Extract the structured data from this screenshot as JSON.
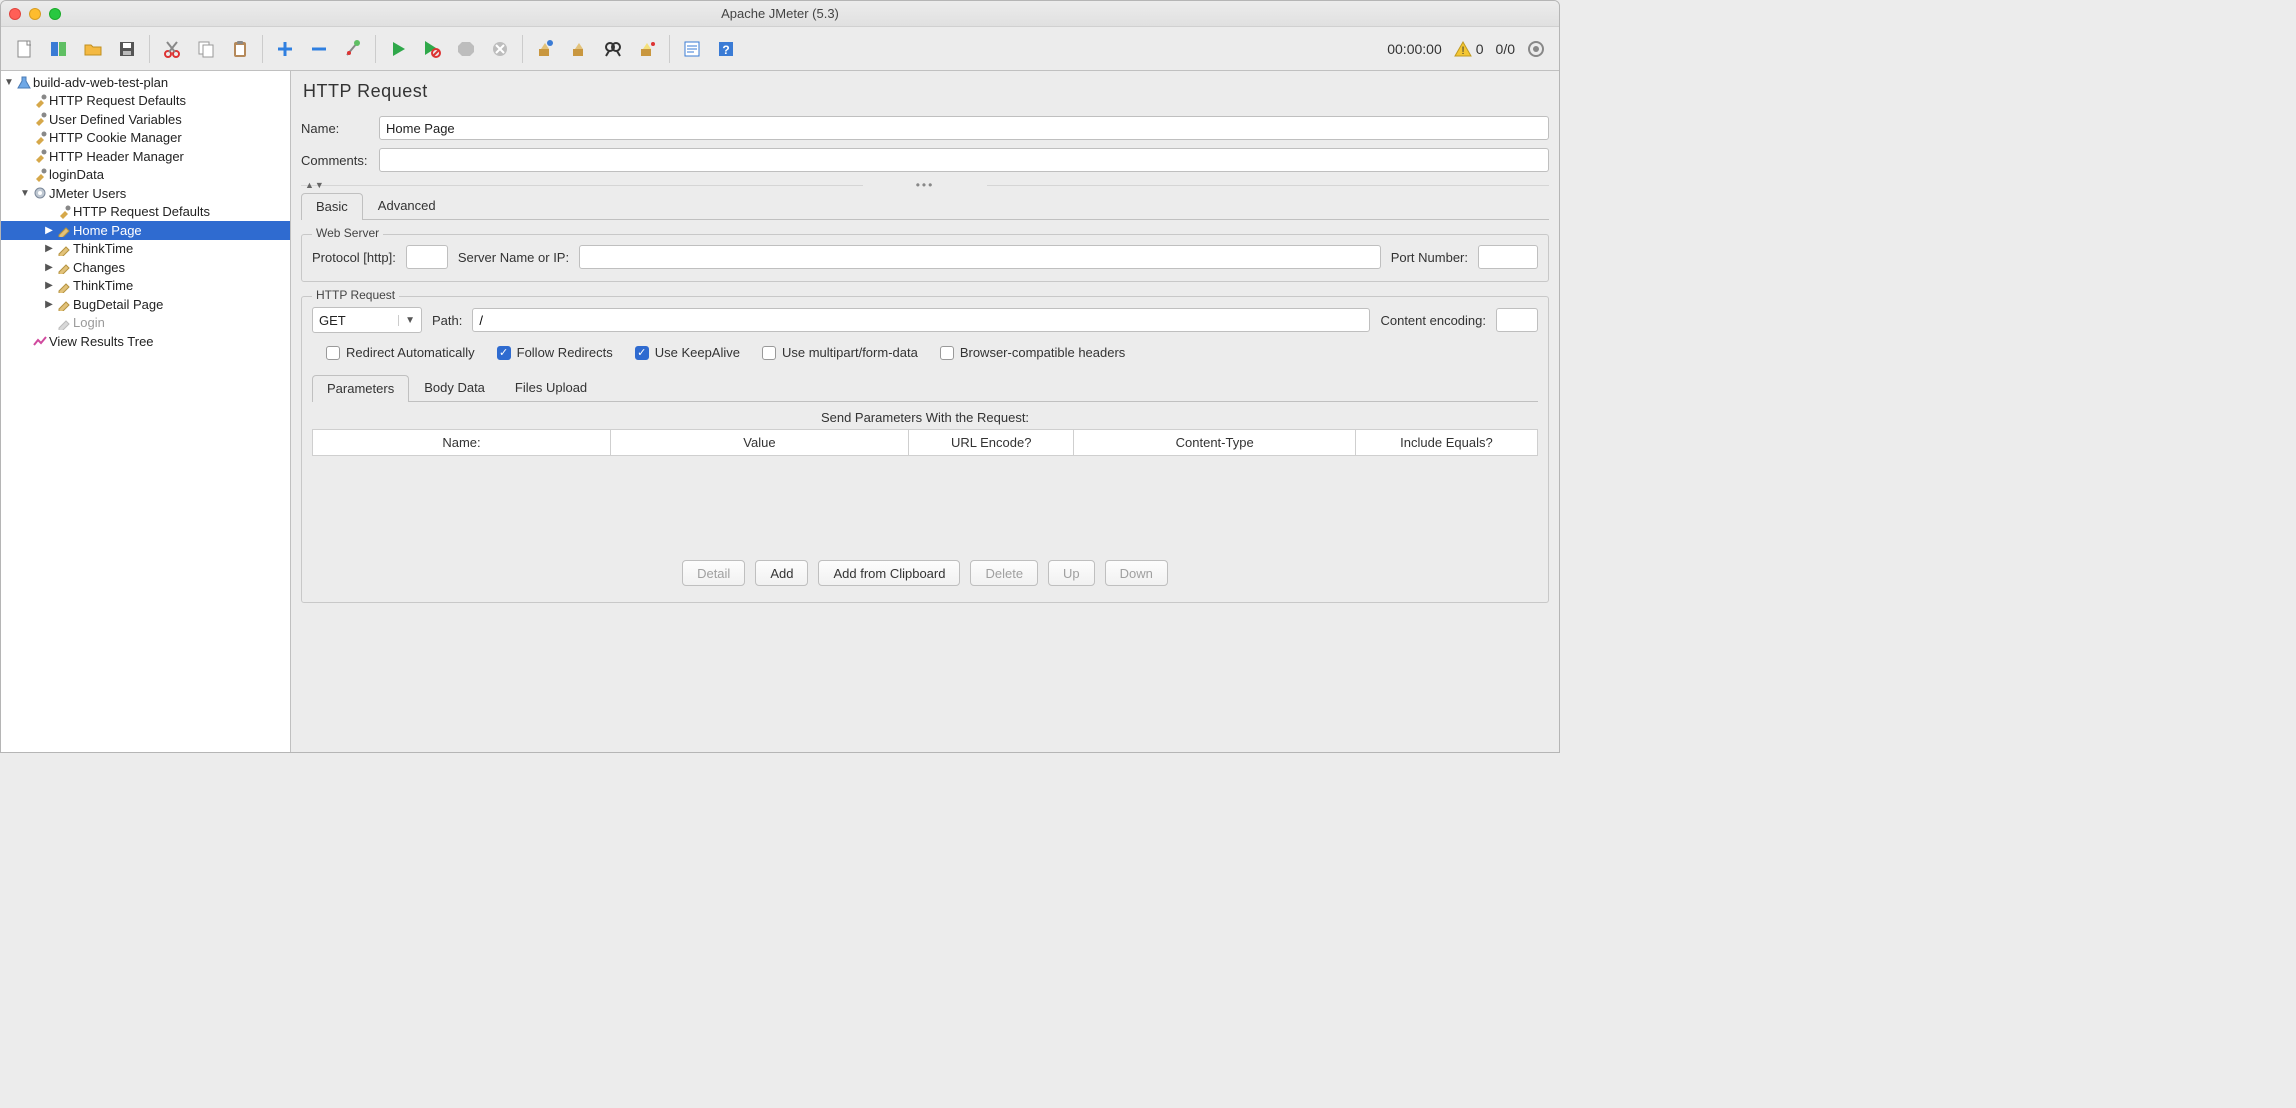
{
  "window": {
    "title": "Apache JMeter (5.3)"
  },
  "status": {
    "time": "00:00:00",
    "warnings": "0",
    "threads": "0/0"
  },
  "tree": {
    "root": "build-adv-web-test-plan",
    "children": [
      {
        "label": "HTTP Request Defaults",
        "icon": "wrench"
      },
      {
        "label": "User Defined Variables",
        "icon": "wrench"
      },
      {
        "label": "HTTP Cookie Manager",
        "icon": "wrench"
      },
      {
        "label": "HTTP Header Manager",
        "icon": "wrench"
      },
      {
        "label": "loginData",
        "icon": "wrench"
      }
    ],
    "threadGroup": {
      "label": "JMeter Users",
      "children": [
        {
          "label": "HTTP Request Defaults",
          "icon": "wrench",
          "expand": false
        },
        {
          "label": "Home Page",
          "icon": "pencil",
          "expand": true,
          "selected": true
        },
        {
          "label": "ThinkTime",
          "icon": "pencil",
          "expand": true
        },
        {
          "label": "Changes",
          "icon": "pencil",
          "expand": true
        },
        {
          "label": "ThinkTime",
          "icon": "pencil",
          "expand": true
        },
        {
          "label": "BugDetail Page",
          "icon": "pencil",
          "expand": true
        },
        {
          "label": "Login",
          "icon": "pencil",
          "expand": false,
          "disabled": true
        }
      ],
      "after": {
        "label": "View Results Tree",
        "icon": "chart"
      }
    }
  },
  "panel": {
    "title": "HTTP Request",
    "nameLabel": "Name:",
    "nameValue": "Home Page",
    "commentsLabel": "Comments:",
    "commentsValue": "",
    "tabs": {
      "basic": "Basic",
      "advanced": "Advanced",
      "active": "basic"
    },
    "webServer": {
      "title": "Web Server",
      "protocolLabel": "Protocol [http]:",
      "protocolValue": "",
      "serverLabel": "Server Name or IP:",
      "serverValue": "",
      "portLabel": "Port Number:",
      "portValue": ""
    },
    "httpRequest": {
      "title": "HTTP Request",
      "method": "GET",
      "pathLabel": "Path:",
      "pathValue": "/",
      "encodingLabel": "Content encoding:",
      "encodingValue": "",
      "checks": {
        "redirectAuto": {
          "label": "Redirect Automatically",
          "checked": false
        },
        "followRedirects": {
          "label": "Follow Redirects",
          "checked": true
        },
        "keepAlive": {
          "label": "Use KeepAlive",
          "checked": true
        },
        "multipart": {
          "label": "Use multipart/form-data",
          "checked": false
        },
        "browserHeaders": {
          "label": "Browser-compatible headers",
          "checked": false
        }
      }
    },
    "subTabs": {
      "parameters": "Parameters",
      "bodyData": "Body Data",
      "filesUpload": "Files Upload",
      "active": "parameters"
    },
    "table": {
      "caption": "Send Parameters With the Request:",
      "columns": [
        "Name:",
        "Value",
        "URL Encode?",
        "Content-Type",
        "Include Equals?"
      ]
    },
    "buttons": {
      "detail": "Detail",
      "add": "Add",
      "addClipboard": "Add from Clipboard",
      "delete": "Delete",
      "up": "Up",
      "down": "Down"
    }
  }
}
